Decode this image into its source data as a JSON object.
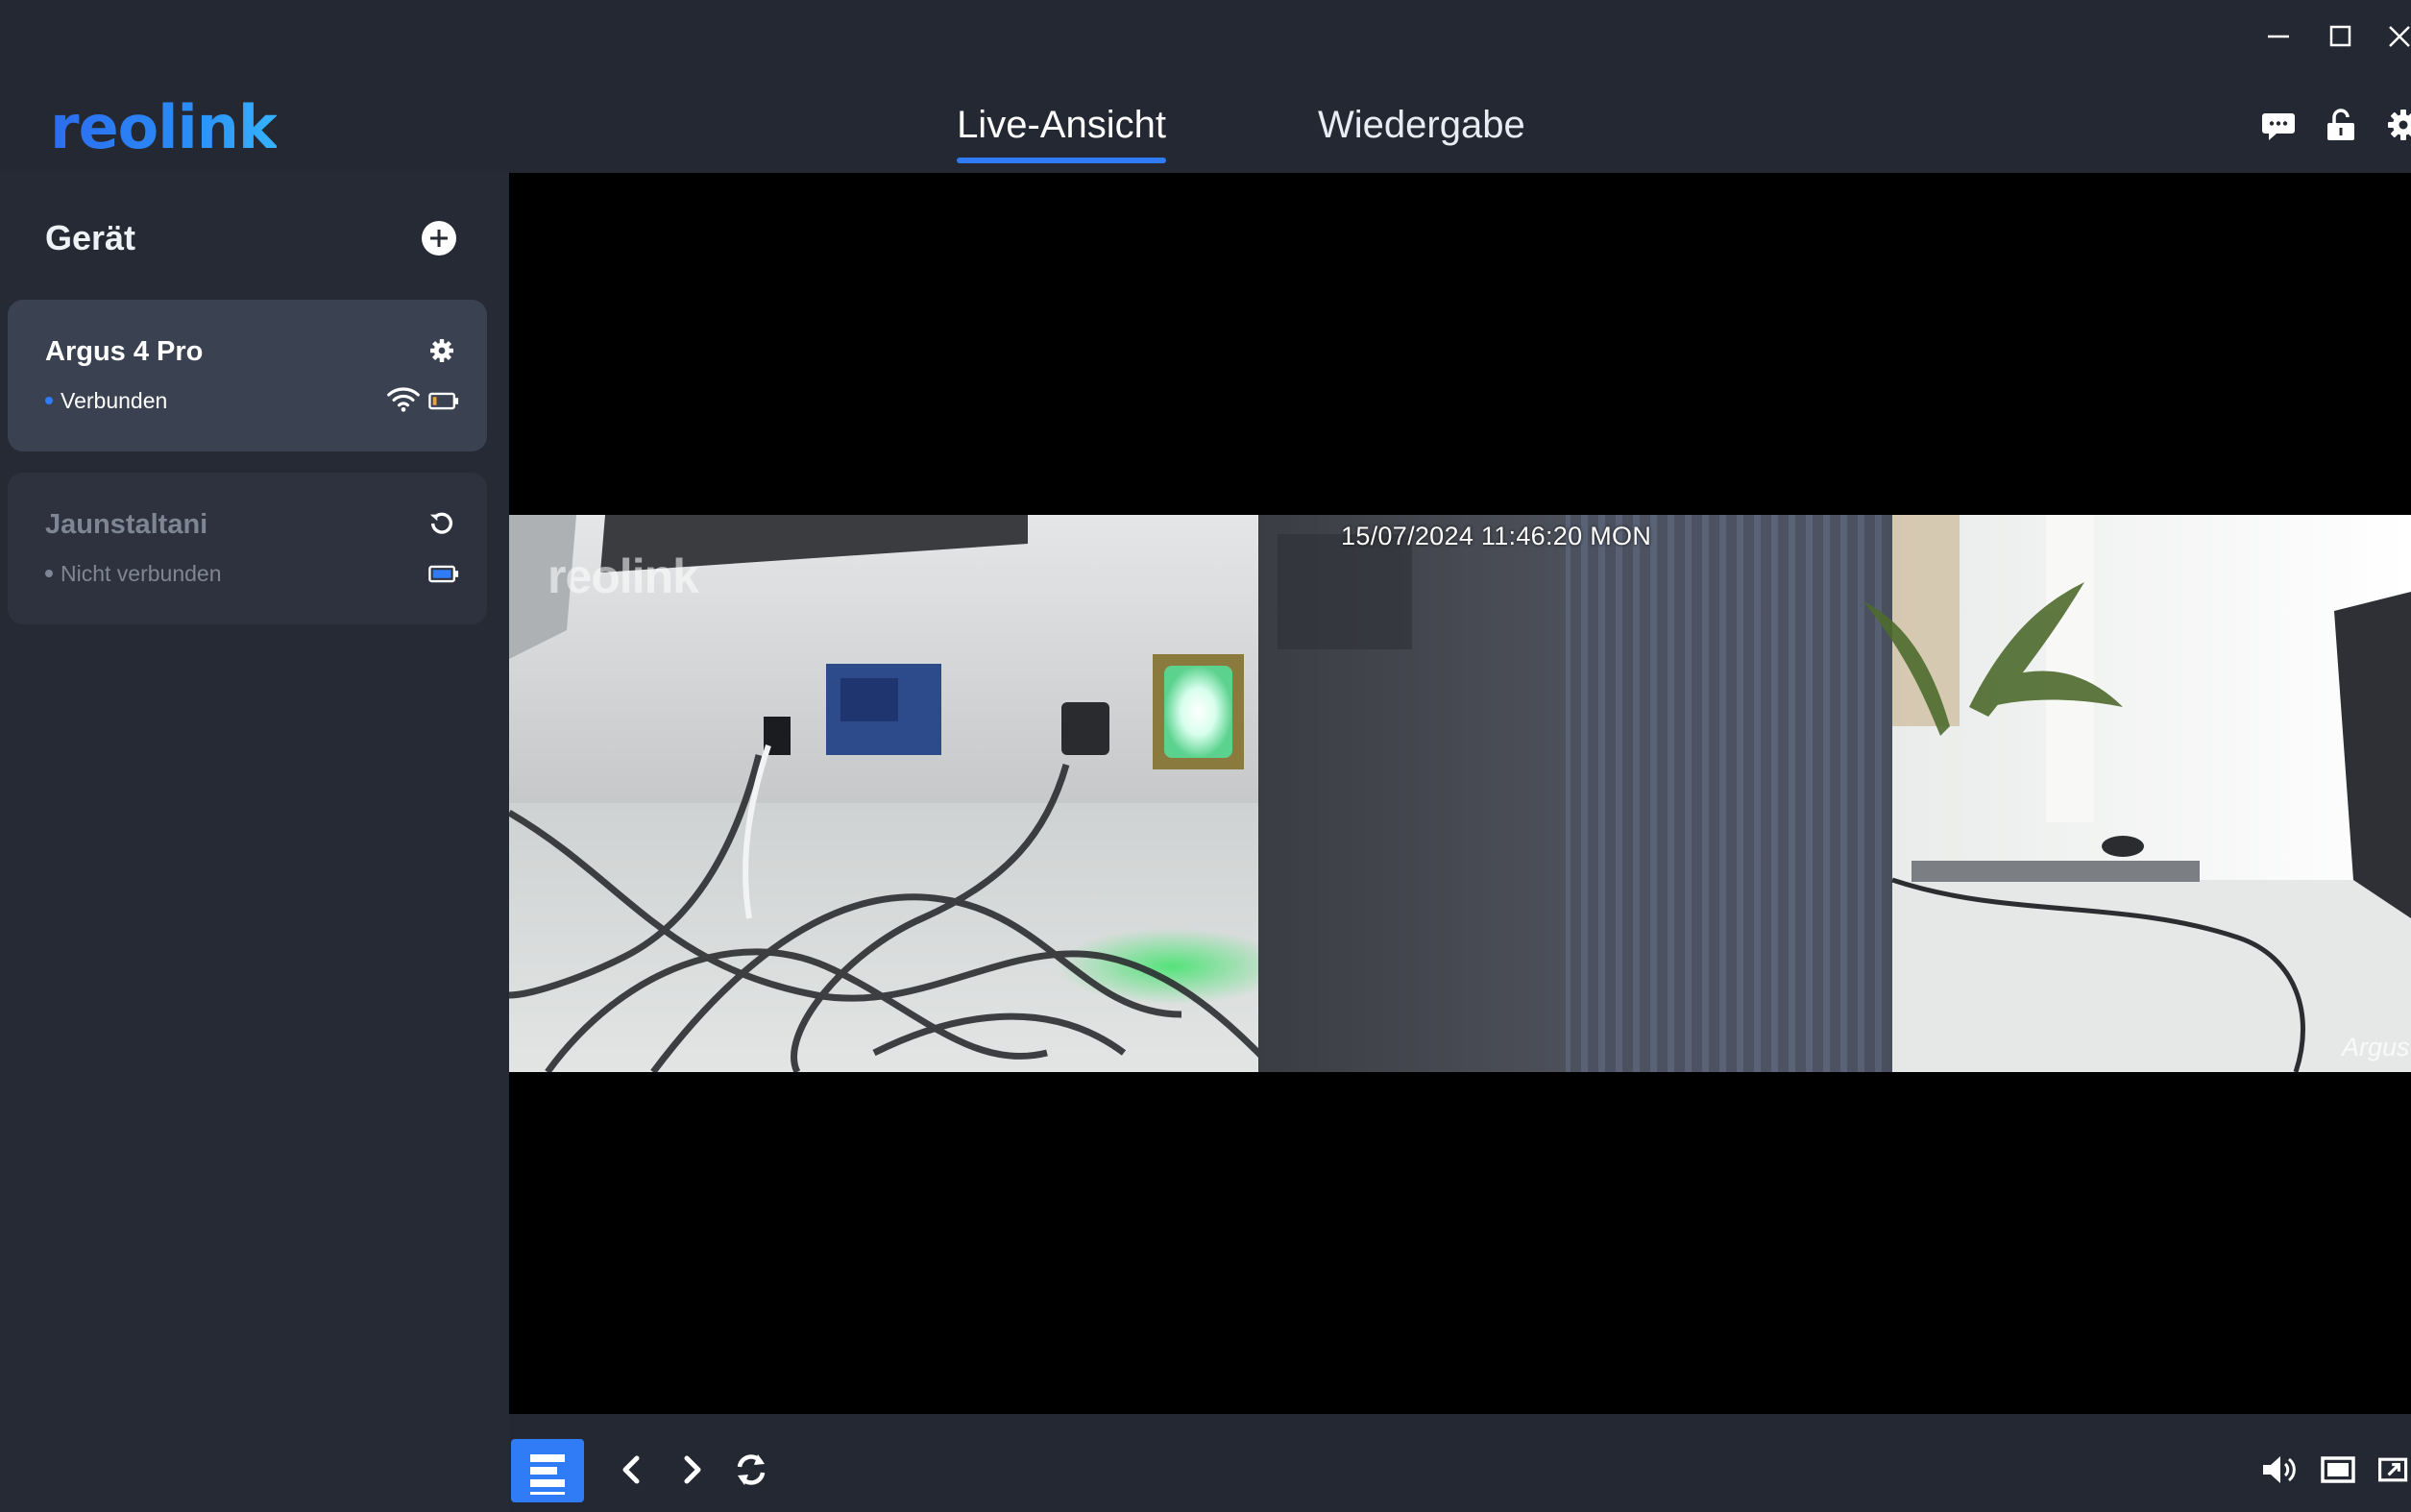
{
  "window": {
    "controls": [
      "minimize-icon",
      "maximize-icon",
      "close-icon"
    ]
  },
  "header": {
    "logo_text": "reolink",
    "tabs": [
      {
        "label": "Live-Ansicht",
        "active": true
      },
      {
        "label": "Wiedergabe",
        "active": false
      }
    ],
    "icons": [
      "message-icon",
      "unlock-icon",
      "gear-icon"
    ],
    "accent_color": "#2f7cf6"
  },
  "sidebar": {
    "title": "Gerät",
    "add_icon": "plus-circle-icon",
    "devices": [
      {
        "name": "Argus 4 Pro",
        "status": "Verbunden",
        "connected": true,
        "icons": [
          "gear-icon",
          "wifi-icon",
          "battery-low-icon"
        ]
      },
      {
        "name": "Jaunstaltani",
        "status": "Nicht verbunden",
        "connected": false,
        "icons": [
          "reconnect-icon",
          "battery-full-icon"
        ]
      }
    ]
  },
  "video": {
    "timestamp": "15/07/2024 11:46:20 MON",
    "watermark": "reolink",
    "camera_label": "Argus"
  },
  "toolbar": {
    "left_icons": [
      "layout-list-icon",
      "chevron-left-icon",
      "chevron-right-icon",
      "refresh-icon"
    ],
    "right_icons": [
      "volume-icon",
      "window-icon",
      "fullscreen-icon"
    ]
  }
}
